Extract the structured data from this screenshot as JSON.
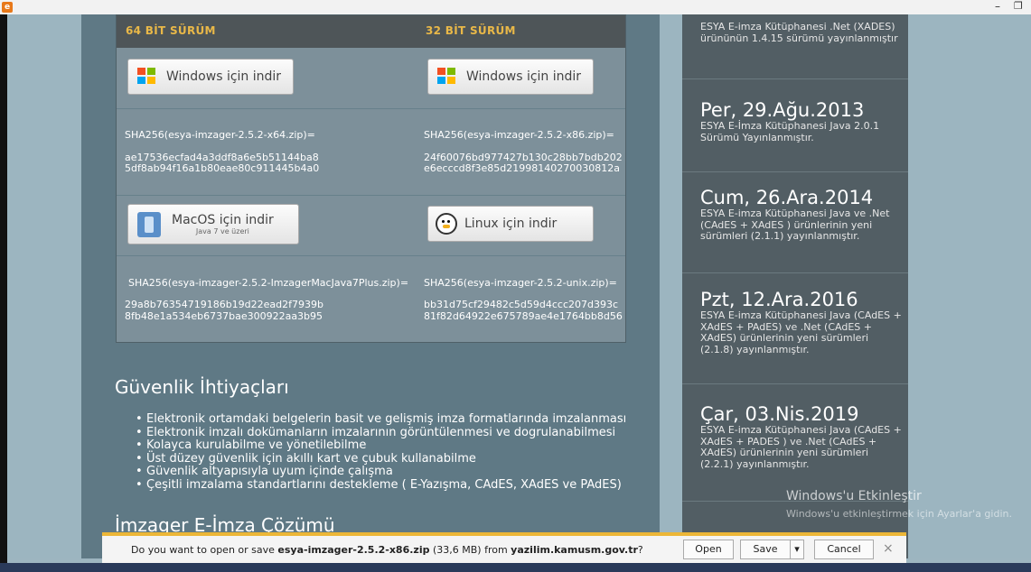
{
  "download_table": {
    "headers": [
      "64 BİT SÜRÜM",
      "32 BİT SÜRÜM"
    ],
    "windows_button": "Windows için indir",
    "macos_button": "MacOS için indir",
    "macos_sub": "Java 7 ve üzeri",
    "linux_button": "Linux için indir",
    "x64_label": "SHA256(esya-imzager-2.5.2-x64.zip)=",
    "x64_hash1": "ae17536ecfad4a3ddf8a6e5b51144ba8",
    "x64_hash2": "5df8ab94f16a1b80eae80c911445b4a0",
    "x86_label": "SHA256(esya-imzager-2.5.2-x86.zip)=",
    "x86_hash1": "24f60076bd977427b130c28bb7bdb202",
    "x86_hash2": "e6ecccd8f3e85d21998140270030812a",
    "mac_label": "SHA256(esya-imzager-2.5.2-ImzagerMacJava7Plus.zip)=",
    "mac_hash1": "29a8b76354719186b19d22ead2f7939b",
    "mac_hash2": "8fb48e1a534eb6737bae300922aa3b95",
    "unix_label": "SHA256(esya-imzager-2.5.2-unix.zip)=",
    "unix_hash1": "bb31d75cf29482c5d59d4ccc207d393c",
    "unix_hash2": "81f82d64922e675789ae4e1764bb8d56"
  },
  "security": {
    "title": "Güvenlik İhtiyaçları",
    "items": [
      "Elektronik ortamdaki belgelerin basit ve gelişmiş imza formatlarında imzalanması",
      "Elektronik imzalı dokümanların imzalarının görüntülenmesi ve dogrulanabilmesi",
      "Kolayca kurulabilme ve yönetilebilme",
      "Üst düzey güvenlik için akıllı kart ve çubuk kullanabilme",
      "Güvenlik altyapısıyla uyum içinde çalışma",
      "Çeşitli imzalama standartlarını destekleme ( E-Yazışma, CAdES, XAdES ve PAdES)"
    ],
    "next_heading": "İmzager E-İmza Çözümü"
  },
  "news": [
    {
      "date": "",
      "desc": "ESYA E-imza Kütüphanesi .Net (XADES) ürününün 1.4.15 sürümü yayınlanmıştır"
    },
    {
      "date": "Per, 29.Ağu.2013",
      "desc": "ESYA E-İmza Kütüphanesi Java 2.0.1 Sürümü Yayınlanmıştır."
    },
    {
      "date": "Cum, 26.Ara.2014",
      "desc": "ESYA E-imza Kütüphanesi Java ve .Net (CAdES + XAdES ) ürünlerinin yeni sürümleri (2.1.1) yayınlanmıştır."
    },
    {
      "date": "Pzt, 12.Ara.2016",
      "desc": "ESYA E-imza Kütüphanesi Java (CAdES + XAdES + PAdES) ve .Net (CAdES + XAdES) ürünlerinin yeni sürümleri (2.1.8) yayınlanmıştır."
    },
    {
      "date": "Çar, 03.Nis.2019",
      "desc": "ESYA E-imza Kütüphanesi Java (CAdES + XAdES + PADES ) ve .Net (CAdES + XAdES) ürünlerinin yeni sürümleri (2.2.1) yayınlanmıştır."
    }
  ],
  "watermark": {
    "line1": "Windows'u Etkinleştir",
    "line2": "Windows'u etkinleştirmek için Ayarlar'a gidin."
  },
  "download_bar": {
    "prefix": "Do you want to open or save ",
    "filename": "esya-imzager-2.5.2-x86.zip",
    "size": " (33,6 MB) from ",
    "host": "yazilim.kamusm.gov.tr",
    "suffix": "?",
    "open": "Open",
    "save": "Save",
    "dropdown": "▾",
    "cancel": "Cancel",
    "close": "×"
  },
  "colors": {
    "header_text": "#e9b848",
    "download_bar_accent": "#ecb637"
  }
}
